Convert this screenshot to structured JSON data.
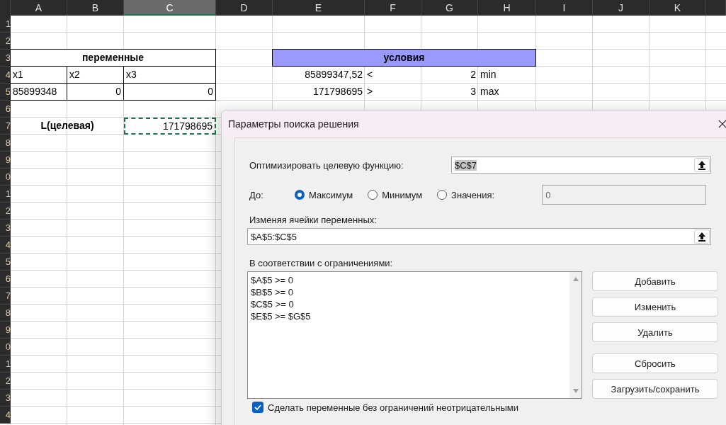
{
  "columns": [
    {
      "label": "A",
      "selected": false
    },
    {
      "label": "B",
      "selected": false
    },
    {
      "label": "C",
      "selected": true
    },
    {
      "label": "D",
      "selected": false
    },
    {
      "label": "E",
      "selected": false
    },
    {
      "label": "F",
      "selected": false
    },
    {
      "label": "G",
      "selected": false
    },
    {
      "label": "H",
      "selected": false
    },
    {
      "label": "I",
      "selected": false
    },
    {
      "label": "J",
      "selected": false
    },
    {
      "label": "K",
      "selected": false
    }
  ],
  "row_headers": [
    "1",
    "2",
    "3",
    "4",
    "5",
    "6",
    "7",
    "8",
    "9",
    "0",
    "1",
    "2",
    "3",
    "4",
    "5",
    "6",
    "7",
    "8",
    "9",
    "0",
    "1",
    "2",
    "3",
    "4"
  ],
  "variables_table": {
    "title": "переменные",
    "headers": [
      "x1",
      "x2",
      "x3"
    ],
    "values": [
      "85899348",
      "0",
      "0"
    ]
  },
  "conditions_table": {
    "title": "условия",
    "rows": [
      {
        "value": "85899347,52",
        "sign": "<",
        "limit": "2",
        "goal": "min"
      },
      {
        "value": "171798695",
        "sign": ">",
        "limit": "3",
        "goal": "max"
      }
    ]
  },
  "objective": {
    "label": "L(целевая)",
    "value": "171798695",
    "selected": true
  },
  "dialog": {
    "title": "Параметры поиска решения",
    "objective": {
      "label": "Оптимизировать целевую функцию:",
      "value": "$C$7",
      "highlighted": true
    },
    "to_label": "До:",
    "options": [
      {
        "label": "Максимум",
        "selected": true
      },
      {
        "label": "Минимум",
        "selected": false
      },
      {
        "label": "Значения:",
        "selected": false
      }
    ],
    "target_value": {
      "value": "0",
      "disabled": true
    },
    "variables": {
      "label": "Изменяя ячейки переменных:",
      "value": "$A$5:$C$5"
    },
    "constraints": {
      "label": "В соответствии с ограничениями:",
      "items": [
        "$A$5 >= 0",
        "$B$5 >= 0",
        "$C$5 >= 0",
        "$E$5 >= $G$5"
      ]
    },
    "buttons": [
      "Добавить",
      "Изменить",
      "Удалить",
      "Сбросить",
      "Загрузить/сохранить"
    ],
    "nonnegative": {
      "label": "Сделать переменные без ограничений неотрицательными",
      "checked": true
    }
  }
}
